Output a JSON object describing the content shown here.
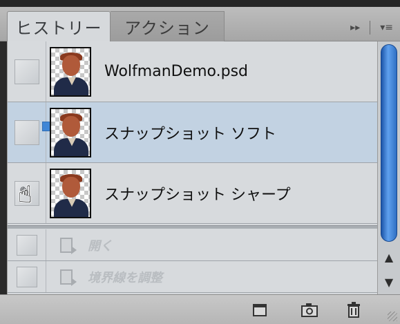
{
  "tabs": [
    {
      "label": "ヒストリー",
      "active": true
    },
    {
      "label": "アクション",
      "active": false
    }
  ],
  "tab_controls": {
    "expand_icon": "▸▸",
    "menu_icon": "▾≡"
  },
  "snapshots": [
    {
      "label": "WolfmanDemo.psd",
      "selected": false,
      "history_source": false
    },
    {
      "label": "スナップショット ソフト",
      "selected": true,
      "history_source": false
    },
    {
      "label": "スナップショット シャープ",
      "selected": false,
      "history_source": true
    }
  ],
  "history_states": [
    {
      "label": "開く"
    },
    {
      "label": "境界線を調整"
    }
  ],
  "bottom_buttons": [
    {
      "name": "new-document-from-state",
      "icon": "document-icon"
    },
    {
      "name": "create-snapshot",
      "icon": "camera-icon"
    },
    {
      "name": "delete-state",
      "icon": "trash-icon"
    }
  ],
  "colors": {
    "selected_row": "#c2d2e2",
    "scroll_thumb": "#3f86d6"
  }
}
